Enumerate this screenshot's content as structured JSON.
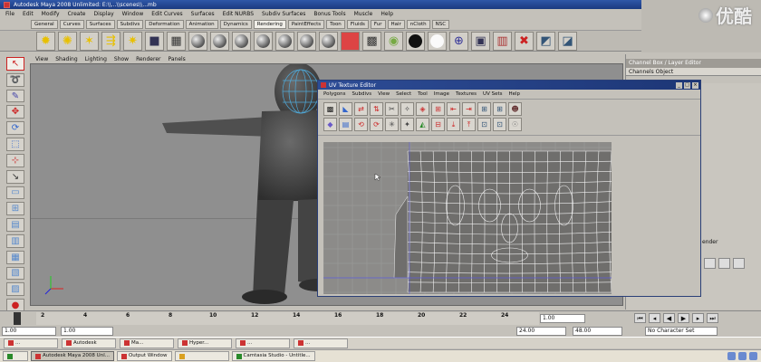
{
  "window": {
    "title": "Autodesk Maya 2008 Unlimited: E:\\\\...\\\\scenes\\\\...mb"
  },
  "menubar": [
    "File",
    "Edit",
    "Modify",
    "Create",
    "Display",
    "Window",
    "Edit Curves",
    "Surfaces",
    "Edit NURBS",
    "Subdiv Surfaces",
    "Bonus Tools",
    "Muscle",
    "Help"
  ],
  "shelf_tabs": [
    {
      "label": "General",
      "active": false
    },
    {
      "label": "Curves",
      "active": false
    },
    {
      "label": "Surfaces",
      "active": false
    },
    {
      "label": "Subdivs",
      "active": false
    },
    {
      "label": "Deformation",
      "active": false
    },
    {
      "label": "Animation",
      "active": false
    },
    {
      "label": "Dynamics",
      "active": false
    },
    {
      "label": "Rendering",
      "active": true
    },
    {
      "label": "PaintEffects",
      "active": false
    },
    {
      "label": "Toon",
      "active": false
    },
    {
      "label": "Fluids",
      "active": false
    },
    {
      "label": "Fur",
      "active": false
    },
    {
      "label": "Hair",
      "active": false
    },
    {
      "label": "nCloth",
      "active": false
    },
    {
      "label": "NSC",
      "active": false
    }
  ],
  "watermark": {
    "text": "优酷"
  },
  "viewport": {
    "menu": [
      "View",
      "Shading",
      "Lighting",
      "Show",
      "Renderer",
      "Panels"
    ]
  },
  "channel_box": {
    "title": "Channel Box / Layer Editor",
    "tabs": "Channels  Object",
    "render_label": "ender"
  },
  "uv_editor": {
    "title": "UV Texture Editor",
    "menu": [
      "Polygons",
      "Subdivs",
      "View",
      "Select",
      "Tool",
      "Image",
      "Textures",
      "UV Sets",
      "Help"
    ]
  },
  "timeline": {
    "ticks": [
      "2",
      "4",
      "6",
      "8",
      "10",
      "12",
      "14",
      "16",
      "18",
      "20",
      "22",
      "24"
    ],
    "current_frame": "1.00"
  },
  "range": {
    "start": "1.00",
    "start2": "1.00",
    "end": "24.00",
    "end2": "48.00",
    "char_set": "No Character Set"
  },
  "taskbar_top": [
    "...",
    "Autodesk",
    "Ma...",
    "Hyper...",
    "...",
    "..."
  ],
  "taskbar": [
    {
      "label": "",
      "active": false
    },
    {
      "label": "Autodesk Maya 2008 Unl...",
      "active": true
    },
    {
      "label": "Output Window",
      "active": false
    },
    {
      "label": "",
      "active": false
    },
    {
      "label": "Camtasia Studio - Untitle...",
      "active": false
    }
  ],
  "colors": {
    "titlebar": "#1b3a80",
    "window_bg": "#c4c1ba",
    "viewport_bg": "#8f8f8f",
    "uv_wire": "#f2f2f2",
    "grid": "#9b9b99"
  }
}
